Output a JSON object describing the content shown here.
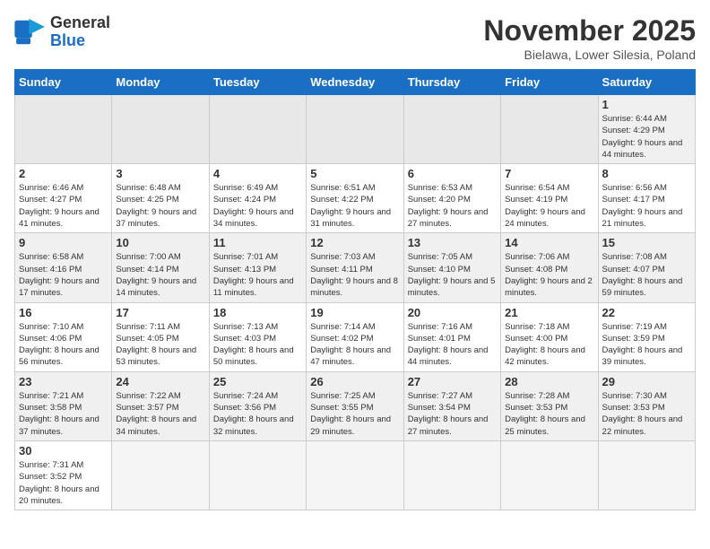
{
  "header": {
    "logo_general": "General",
    "logo_blue": "Blue",
    "month_title": "November 2025",
    "location": "Bielawa, Lower Silesia, Poland"
  },
  "weekdays": [
    "Sunday",
    "Monday",
    "Tuesday",
    "Wednesday",
    "Thursday",
    "Friday",
    "Saturday"
  ],
  "weeks": [
    [
      {
        "day": "",
        "info": ""
      },
      {
        "day": "",
        "info": ""
      },
      {
        "day": "",
        "info": ""
      },
      {
        "day": "",
        "info": ""
      },
      {
        "day": "",
        "info": ""
      },
      {
        "day": "",
        "info": ""
      },
      {
        "day": "1",
        "info": "Sunrise: 6:44 AM\nSunset: 4:29 PM\nDaylight: 9 hours and 44 minutes."
      }
    ],
    [
      {
        "day": "2",
        "info": "Sunrise: 6:46 AM\nSunset: 4:27 PM\nDaylight: 9 hours and 41 minutes."
      },
      {
        "day": "3",
        "info": "Sunrise: 6:48 AM\nSunset: 4:25 PM\nDaylight: 9 hours and 37 minutes."
      },
      {
        "day": "4",
        "info": "Sunrise: 6:49 AM\nSunset: 4:24 PM\nDaylight: 9 hours and 34 minutes."
      },
      {
        "day": "5",
        "info": "Sunrise: 6:51 AM\nSunset: 4:22 PM\nDaylight: 9 hours and 31 minutes."
      },
      {
        "day": "6",
        "info": "Sunrise: 6:53 AM\nSunset: 4:20 PM\nDaylight: 9 hours and 27 minutes."
      },
      {
        "day": "7",
        "info": "Sunrise: 6:54 AM\nSunset: 4:19 PM\nDaylight: 9 hours and 24 minutes."
      },
      {
        "day": "8",
        "info": "Sunrise: 6:56 AM\nSunset: 4:17 PM\nDaylight: 9 hours and 21 minutes."
      }
    ],
    [
      {
        "day": "9",
        "info": "Sunrise: 6:58 AM\nSunset: 4:16 PM\nDaylight: 9 hours and 17 minutes."
      },
      {
        "day": "10",
        "info": "Sunrise: 7:00 AM\nSunset: 4:14 PM\nDaylight: 9 hours and 14 minutes."
      },
      {
        "day": "11",
        "info": "Sunrise: 7:01 AM\nSunset: 4:13 PM\nDaylight: 9 hours and 11 minutes."
      },
      {
        "day": "12",
        "info": "Sunrise: 7:03 AM\nSunset: 4:11 PM\nDaylight: 9 hours and 8 minutes."
      },
      {
        "day": "13",
        "info": "Sunrise: 7:05 AM\nSunset: 4:10 PM\nDaylight: 9 hours and 5 minutes."
      },
      {
        "day": "14",
        "info": "Sunrise: 7:06 AM\nSunset: 4:08 PM\nDaylight: 9 hours and 2 minutes."
      },
      {
        "day": "15",
        "info": "Sunrise: 7:08 AM\nSunset: 4:07 PM\nDaylight: 8 hours and 59 minutes."
      }
    ],
    [
      {
        "day": "16",
        "info": "Sunrise: 7:10 AM\nSunset: 4:06 PM\nDaylight: 8 hours and 56 minutes."
      },
      {
        "day": "17",
        "info": "Sunrise: 7:11 AM\nSunset: 4:05 PM\nDaylight: 8 hours and 53 minutes."
      },
      {
        "day": "18",
        "info": "Sunrise: 7:13 AM\nSunset: 4:03 PM\nDaylight: 8 hours and 50 minutes."
      },
      {
        "day": "19",
        "info": "Sunrise: 7:14 AM\nSunset: 4:02 PM\nDaylight: 8 hours and 47 minutes."
      },
      {
        "day": "20",
        "info": "Sunrise: 7:16 AM\nSunset: 4:01 PM\nDaylight: 8 hours and 44 minutes."
      },
      {
        "day": "21",
        "info": "Sunrise: 7:18 AM\nSunset: 4:00 PM\nDaylight: 8 hours and 42 minutes."
      },
      {
        "day": "22",
        "info": "Sunrise: 7:19 AM\nSunset: 3:59 PM\nDaylight: 8 hours and 39 minutes."
      }
    ],
    [
      {
        "day": "23",
        "info": "Sunrise: 7:21 AM\nSunset: 3:58 PM\nDaylight: 8 hours and 37 minutes."
      },
      {
        "day": "24",
        "info": "Sunrise: 7:22 AM\nSunset: 3:57 PM\nDaylight: 8 hours and 34 minutes."
      },
      {
        "day": "25",
        "info": "Sunrise: 7:24 AM\nSunset: 3:56 PM\nDaylight: 8 hours and 32 minutes."
      },
      {
        "day": "26",
        "info": "Sunrise: 7:25 AM\nSunset: 3:55 PM\nDaylight: 8 hours and 29 minutes."
      },
      {
        "day": "27",
        "info": "Sunrise: 7:27 AM\nSunset: 3:54 PM\nDaylight: 8 hours and 27 minutes."
      },
      {
        "day": "28",
        "info": "Sunrise: 7:28 AM\nSunset: 3:53 PM\nDaylight: 8 hours and 25 minutes."
      },
      {
        "day": "29",
        "info": "Sunrise: 7:30 AM\nSunset: 3:53 PM\nDaylight: 8 hours and 22 minutes."
      }
    ],
    [
      {
        "day": "30",
        "info": "Sunrise: 7:31 AM\nSunset: 3:52 PM\nDaylight: 8 hours and 20 minutes."
      },
      {
        "day": "",
        "info": ""
      },
      {
        "day": "",
        "info": ""
      },
      {
        "day": "",
        "info": ""
      },
      {
        "day": "",
        "info": ""
      },
      {
        "day": "",
        "info": ""
      },
      {
        "day": "",
        "info": ""
      }
    ]
  ]
}
